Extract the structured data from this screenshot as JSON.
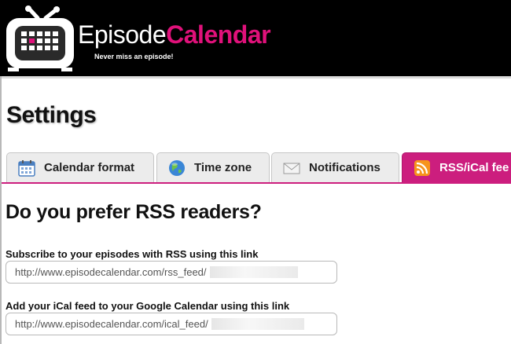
{
  "header": {
    "brand_part1": "Episode",
    "brand_part2": "Calendar",
    "tagline": "Never miss an episode!",
    "colors": {
      "background": "#000000",
      "accent": "#e0117a"
    }
  },
  "page": {
    "title": "Settings"
  },
  "tabs": [
    {
      "label": "Calendar format",
      "icon": "calendar-icon",
      "active": false
    },
    {
      "label": "Time zone",
      "icon": "globe-icon",
      "active": false
    },
    {
      "label": "Notifications",
      "icon": "envelope-icon",
      "active": false
    },
    {
      "label": "RSS/iCal fee",
      "icon": "rss-icon",
      "active": true
    }
  ],
  "section": {
    "heading": "Do you prefer RSS readers?",
    "rss_label": "Subscribe to your episodes with RSS using this link",
    "rss_url": "http://www.episodecalendar.com/rss_feed/",
    "ical_label": "Add your iCal feed to your Google Calendar using this link",
    "ical_url": "http://www.episodecalendar.com/ical_feed/"
  },
  "colors": {
    "active_tab": "#cc1e7e",
    "tab_bg": "#ececec"
  }
}
